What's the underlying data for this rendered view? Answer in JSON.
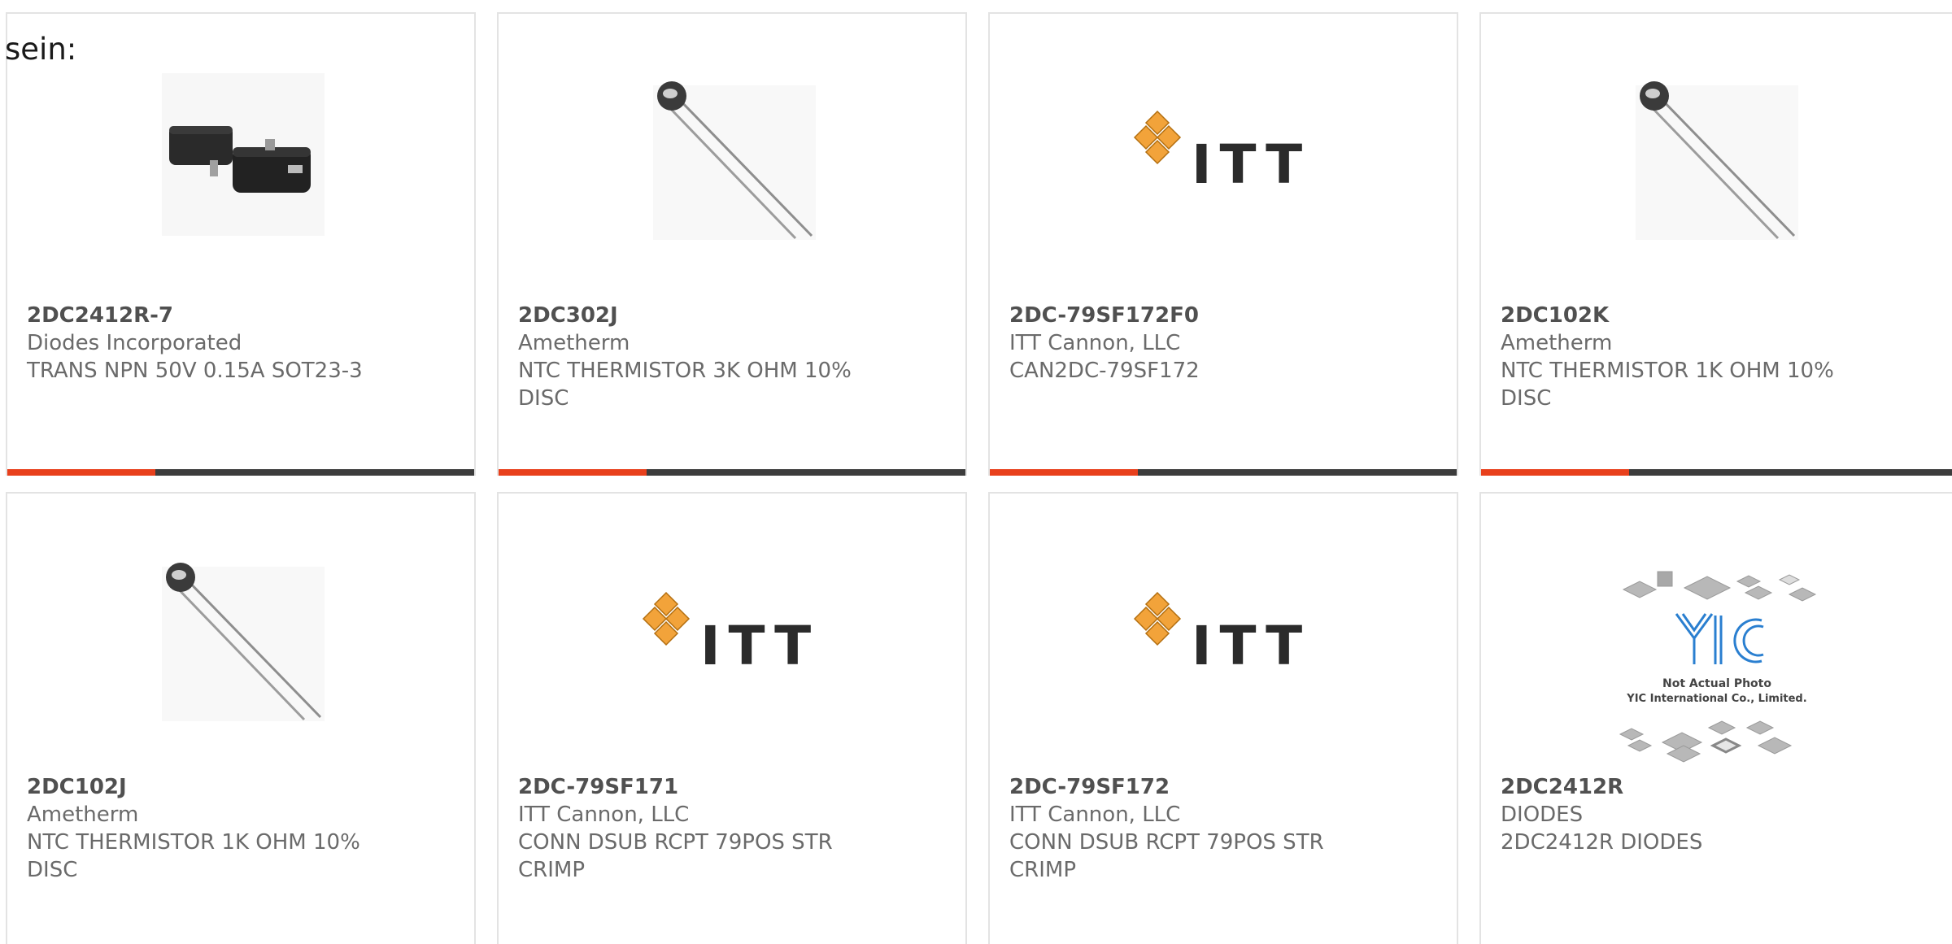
{
  "page": {
    "lead_text": "sein:"
  },
  "colors": {
    "accent": "#e8401c",
    "bar_dark": "#3c3c3c",
    "card_border": "#e3e3e3",
    "itt_orange": "#f2a33a",
    "yic_blue": "#2a7fd0"
  },
  "cards": [
    {
      "part_number": "2DC2412R-7",
      "manufacturer": "Diodes Incorporated",
      "description": "TRANS NPN 50V 0.15A SOT23-3",
      "image": "sot23-package"
    },
    {
      "part_number": "2DC302J",
      "manufacturer": "Ametherm",
      "description": "NTC THERMISTOR 3K OHM 10% DISC",
      "image": "thermistor"
    },
    {
      "part_number": "2DC-79SF172F0",
      "manufacturer": "ITT Cannon, LLC",
      "description": "CAN2DC-79SF172",
      "image": "itt-logo",
      "logo_text": "ITT"
    },
    {
      "part_number": "2DC102K",
      "manufacturer": "Ametherm",
      "description": "NTC THERMISTOR 1K OHM 10% DISC",
      "image": "thermistor"
    },
    {
      "part_number": "2DC102J",
      "manufacturer": "Ametherm",
      "description": "NTC THERMISTOR 1K OHM 10% DISC",
      "image": "thermistor"
    },
    {
      "part_number": "2DC-79SF171",
      "manufacturer": "ITT Cannon, LLC",
      "description": "CONN DSUB RCPT 79POS STR CRIMP",
      "image": "itt-logo",
      "logo_text": "ITT"
    },
    {
      "part_number": "2DC-79SF172",
      "manufacturer": "ITT Cannon, LLC",
      "description": "CONN DSUB RCPT 79POS STR CRIMP",
      "image": "itt-logo",
      "logo_text": "ITT"
    },
    {
      "part_number": "2DC2412R",
      "manufacturer": "DIODES",
      "description": "2DC2412R DIODES",
      "image": "yic-placeholder",
      "logo_text": "YIC",
      "photo_note": "Not Actual Photo",
      "company_note": "YIC International Co., Limited."
    }
  ]
}
